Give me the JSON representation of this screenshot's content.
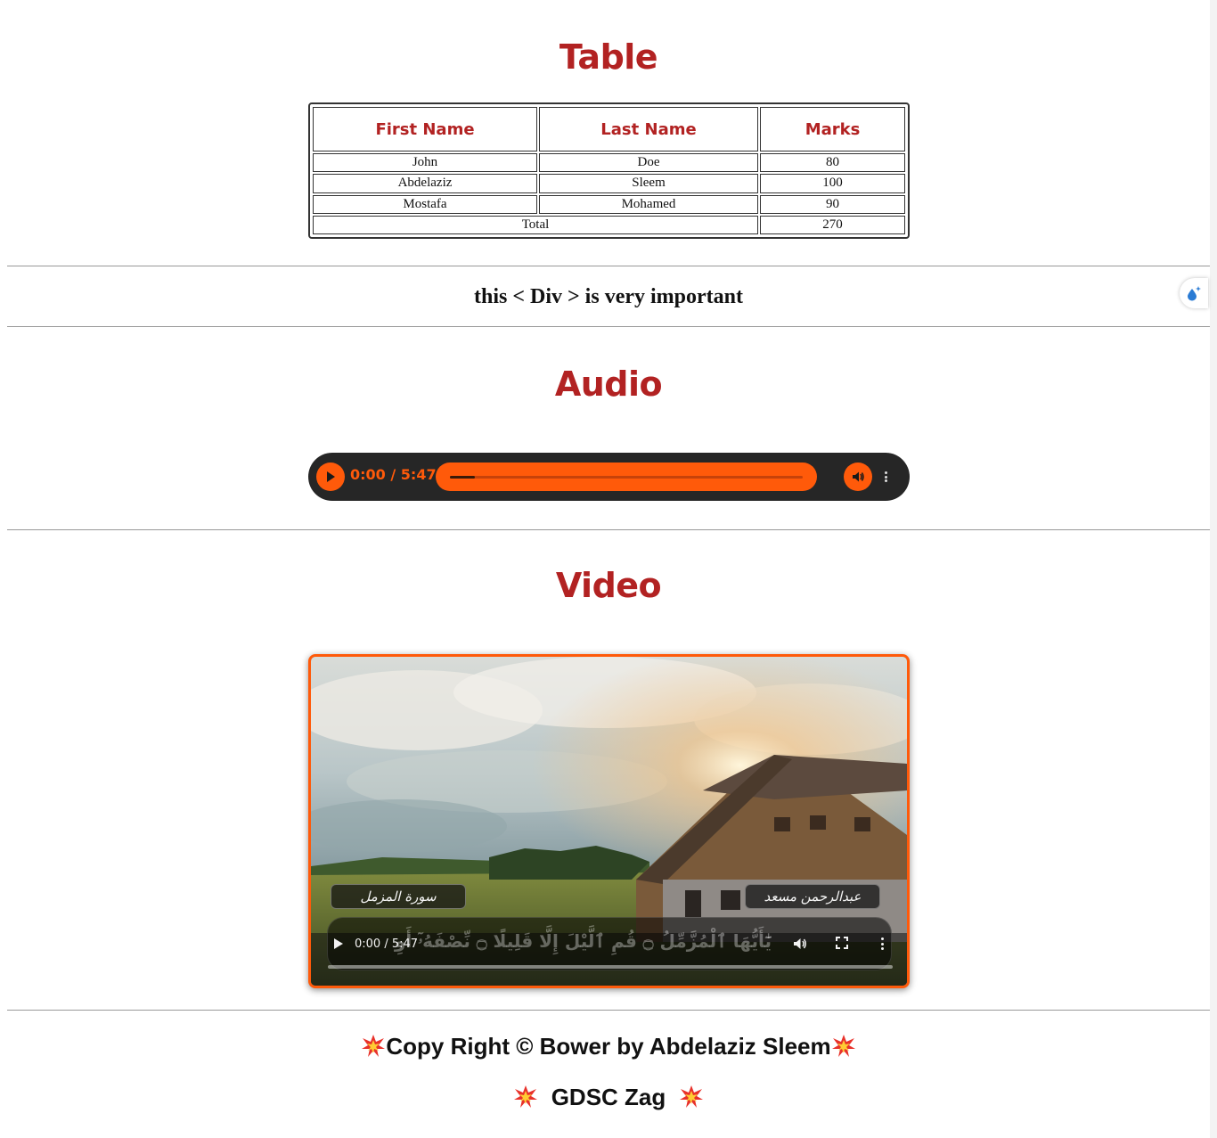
{
  "sections": {
    "table_heading": "Table",
    "audio_heading": "Audio",
    "video_heading": "Video"
  },
  "table": {
    "headers": [
      "First Name",
      "Last Name",
      "Marks"
    ],
    "rows": [
      {
        "first": "John",
        "last": "Doe",
        "marks": "80"
      },
      {
        "first": "Abdelaziz",
        "last": "Sleem",
        "marks": "100"
      },
      {
        "first": "Mostafa",
        "last": "Mohamed",
        "marks": "90"
      }
    ],
    "total_label": "Total",
    "total_value": "270"
  },
  "important_text": "this < Div > is very important",
  "audio": {
    "time": "0:00 / 5:47",
    "progress": 0.07,
    "accent": "#ff5a0a",
    "background": "#262626"
  },
  "video": {
    "time": "0:00 / 5:47",
    "progress": 0,
    "surah_label": "سورة المزمل",
    "reciter_label": "عبدالرحمن مسعد",
    "verse_text": "يَٰٓأَيُّهَا ٱلْمُزَّمِّلُ ۝ قُمِ ٱلَّيْلَ إِلَّا قَلِيلًا ۝ نِّصْفَهُۥٓ أَوِ ٱنقُصْ مِنْهُ قَلِيلًا",
    "border_color": "#ff5a0a"
  },
  "footer": {
    "line1": "Copy Right © Bower by Abdelaziz Sleem",
    "line2": "GDSC Zag",
    "icon": "collision-icon"
  },
  "colors": {
    "heading": "#b22222",
    "divider": "#999999"
  }
}
